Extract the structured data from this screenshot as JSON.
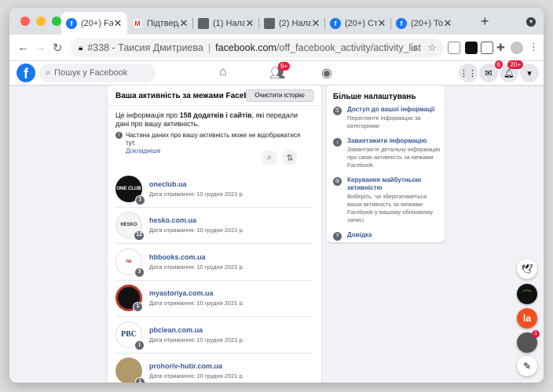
{
  "browser": {
    "tabs": [
      {
        "title": "(20+) Fac",
        "favicon": "facebook-icon",
        "active": true
      },
      {
        "title": "Підтвердж",
        "favicon": "gmail-icon",
        "active": false
      },
      {
        "title": "(1) Налаш",
        "favicon": "page-icon",
        "active": false
      },
      {
        "title": "(2) Налаш",
        "favicon": "page-icon",
        "active": false
      },
      {
        "title": "(20+) Сто",
        "favicon": "facebook-icon",
        "active": false
      },
      {
        "title": "(20+) Тое",
        "favicon": "facebook-icon",
        "active": false
      }
    ],
    "new_tab_symbol": "+",
    "close_symbol": "✕",
    "omnibox": {
      "title": "#338 - Таисия Дмитриева",
      "host": "facebook.com",
      "path": "/off_facebook_activity/activity_list"
    }
  },
  "facebook": {
    "logo_letter": "f",
    "search_placeholder": "Пошук у Facebook",
    "friends_badge": "9+",
    "messenger_badge": "6",
    "notifications_badge": "20+"
  },
  "activity": {
    "title": "Ваша активність за межами Facebook",
    "clear_button": "Очистити історію",
    "desc_prefix": "Це інформація про ",
    "desc_count": "158 додатків і сайтів",
    "desc_suffix": ", які передали дані про вашу активність.",
    "note": "Частина даних про вашу активність може не відображатися тут.",
    "note_link": "Докладніше",
    "apps": [
      {
        "name": "oneclub.ua",
        "date": "Дата отримання: 10 грудня 2021 р.",
        "count": "1",
        "thumb_text": "ONE CLUB"
      },
      {
        "name": "hesko.com.ua",
        "date": "Дата отримання: 10 грудня 2021 р.",
        "count": "12",
        "thumb_text": "HESKO"
      },
      {
        "name": "hbbooks.com.ua",
        "date": "Дата отримання: 10 грудня 2021 р.",
        "count": "3",
        "thumb_text": "hb"
      },
      {
        "name": "myastoriya.com.ua",
        "date": "Дата отримання: 10 грудня 2021 р.",
        "count": "1",
        "thumb_text": ""
      },
      {
        "name": "pbclean.com.ua",
        "date": "Дата отримання: 10 грудня 2021 р.",
        "count": "1",
        "thumb_text": "PBC"
      },
      {
        "name": "prohoriv-hutir.com.ua",
        "date": "Дата отримання: 10 грудня 2021 р.",
        "count": "1",
        "thumb_text": ""
      }
    ]
  },
  "more_settings": {
    "title": "Більше налаштувань",
    "items": [
      {
        "link": "Доступ до вашої інформації",
        "text": "Переглянте інформацію за категоріями"
      },
      {
        "link": "Завантажити інформацію",
        "text": "Завантажте детальну інформацію про свою активність за межами Facebook"
      },
      {
        "link": "Керування майбутньою активністю",
        "text": "Виберіть, чи зберігатиметься ваша активність за межами Facebook у вашому обліковому записі"
      },
      {
        "link": "Довідка",
        "text": ""
      }
    ]
  },
  "floating": {
    "avatar_badge": "1"
  },
  "colors": {
    "fb_blue": "#1877f2",
    "link_blue": "#385898",
    "badge_red": "#e41e3f"
  }
}
